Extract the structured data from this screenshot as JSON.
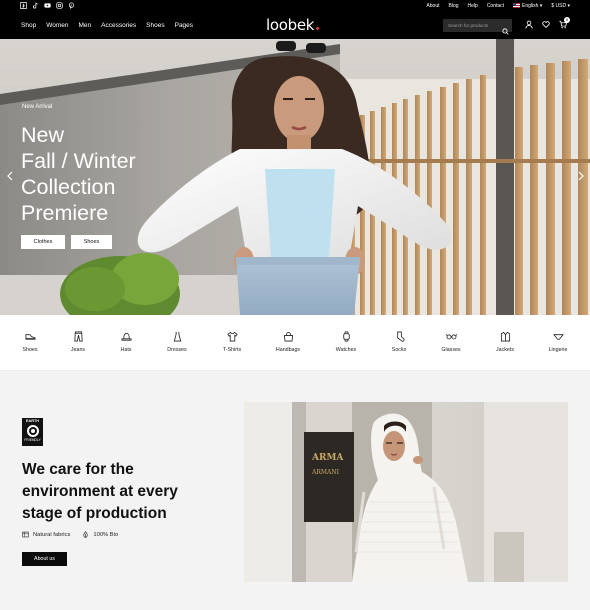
{
  "topbar": {
    "social_icons": [
      "facebook-icon",
      "tiktok-icon",
      "youtube-icon",
      "instagram-icon",
      "pinterest-icon"
    ],
    "links": [
      "About",
      "Blog",
      "Help",
      "Contact"
    ],
    "language": "English",
    "currency": "$ USD"
  },
  "header": {
    "nav": [
      "Shop",
      "Women",
      "Men",
      "Accessories",
      "Shoes",
      "Pages"
    ],
    "logo": "loobek",
    "search_placeholder": "Search for products",
    "cart_count": "0",
    "colors": {
      "background": "#000000",
      "logo_dot": "#e5364a"
    }
  },
  "hero": {
    "kicker": "New Arrival",
    "title_lines": [
      "New",
      "Fall / Winter",
      "Collection",
      "Premiere"
    ],
    "buttons": [
      "Clothes",
      "Shoes"
    ]
  },
  "categories": [
    {
      "label": "Shoes",
      "icon": "shoe-icon"
    },
    {
      "label": "Jeans",
      "icon": "jeans-icon"
    },
    {
      "label": "Hats",
      "icon": "hat-icon"
    },
    {
      "label": "Dresses",
      "icon": "dress-icon"
    },
    {
      "label": "T-Shirts",
      "icon": "tshirt-icon"
    },
    {
      "label": "Handbags",
      "icon": "handbag-icon"
    },
    {
      "label": "Watches",
      "icon": "watch-icon"
    },
    {
      "label": "Socks",
      "icon": "sock-icon"
    },
    {
      "label": "Glasses",
      "icon": "glasses-icon"
    },
    {
      "label": "Jackets",
      "icon": "jacket-icon"
    },
    {
      "label": "Lingerie",
      "icon": "lingerie-icon"
    }
  ],
  "eco": {
    "badge_top": "EARTH",
    "badge_bottom": "FRIENDLY",
    "title_lines": [
      "We care for the",
      "environment at every",
      "stage of production"
    ],
    "features": [
      "Natural fabrics",
      "100% Bio"
    ],
    "button": "About us"
  }
}
